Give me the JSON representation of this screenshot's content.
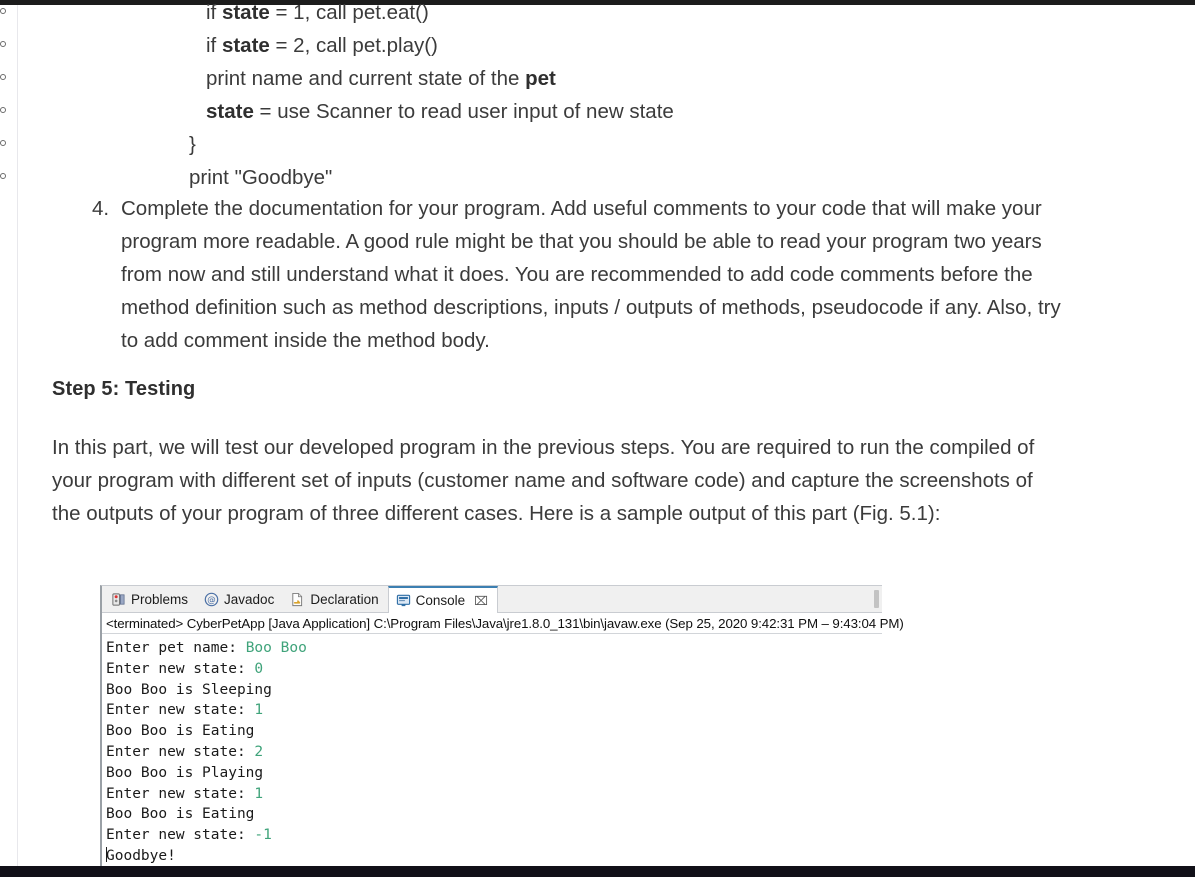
{
  "document": {
    "sub_bullets": [
      {
        "level": "a",
        "segments": [
          {
            "t": "if ",
            "b": false
          },
          {
            "t": "state",
            "b": true
          },
          {
            "t": " = 1, call pet.eat()",
            "b": false
          }
        ]
      },
      {
        "level": "a",
        "segments": [
          {
            "t": "if ",
            "b": false
          },
          {
            "t": "state",
            "b": true
          },
          {
            "t": " = 2, call pet.play()",
            "b": false
          }
        ]
      },
      {
        "level": "a",
        "segments": [
          {
            "t": "print name and current state of the ",
            "b": false
          },
          {
            "t": "pet",
            "b": true
          }
        ]
      },
      {
        "level": "a",
        "segments": [
          {
            "t": "state",
            "b": true
          },
          {
            "t": " = use Scanner to read user input of new state",
            "b": false
          }
        ]
      },
      {
        "level": "b",
        "segments": [
          {
            "t": "}",
            "b": false
          }
        ]
      },
      {
        "level": "b",
        "segments": [
          {
            "t": "print \"Goodbye\"",
            "b": false
          }
        ]
      }
    ],
    "numbered_item": {
      "number": "4.",
      "text": "Complete the documentation for your program. Add useful comments to your code that will make your program more readable. A good rule might be that you should be able to read your program two years from now and still understand what it does. You are recommended to add code comments before the method definition such as method descriptions, inputs / outputs of methods, pseudocode if any. Also, try to add comment inside the method body."
    },
    "heading": "Step 5: Testing",
    "paragraph": "In this part, we will test our developed program in the previous steps. You are required to run the compiled of your program with different set of inputs (customer name and software code) and capture the screenshots of the outputs of your program of three different cases. Here is a sample output of this part (Fig. 5.1):"
  },
  "eclipse": {
    "tabs": [
      {
        "label": "Problems",
        "icon": "problems-icon",
        "active": false,
        "closable": false
      },
      {
        "label": "Javadoc",
        "icon": "javadoc-icon",
        "active": false,
        "closable": false
      },
      {
        "label": "Declaration",
        "icon": "declaration-icon",
        "active": false,
        "closable": false
      },
      {
        "label": "Console",
        "icon": "console-icon",
        "active": true,
        "closable": true
      }
    ],
    "close_glyph": "⌧",
    "launch_line": "<terminated> CyberPetApp [Java Application] C:\\Program Files\\Java\\jre1.8.0_131\\bin\\javaw.exe  (Sep 25, 2020 9:42:31 PM – 9:43:04 PM)",
    "output_lines": [
      {
        "prompt": "Enter pet name: ",
        "input": "Boo Boo",
        "caret": false
      },
      {
        "prompt": "Enter new state: ",
        "input": "0",
        "caret": false
      },
      {
        "prompt": "Boo Boo is Sleeping",
        "input": "",
        "caret": false
      },
      {
        "prompt": "Enter new state: ",
        "input": "1",
        "caret": false
      },
      {
        "prompt": "Boo Boo is Eating",
        "input": "",
        "caret": false
      },
      {
        "prompt": "Enter new state: ",
        "input": "2",
        "caret": false
      },
      {
        "prompt": "Boo Boo is Playing",
        "input": "",
        "caret": false
      },
      {
        "prompt": "Enter new state: ",
        "input": "1",
        "caret": false
      },
      {
        "prompt": "Boo Boo is Eating",
        "input": "",
        "caret": false
      },
      {
        "prompt": "Enter new state: ",
        "input": "-1",
        "caret": false
      },
      {
        "prompt": "Goodbye!",
        "input": "",
        "caret": true
      }
    ],
    "colors": {
      "input_green": "#3fa37a",
      "output_black": "#1a1a1a",
      "active_tab_accent": "#3c7fb1"
    }
  }
}
